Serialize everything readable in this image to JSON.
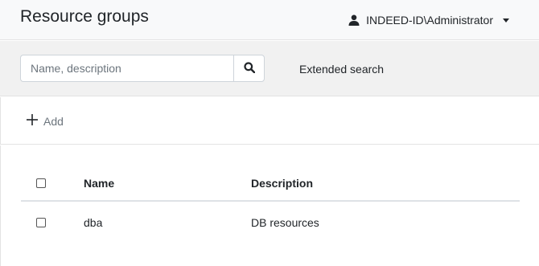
{
  "header": {
    "title": "Resource groups",
    "user": {
      "name": "INDEED-ID\\Administrator",
      "icon": "user-icon"
    }
  },
  "search": {
    "placeholder": "Name, description",
    "value": "",
    "button_icon": "search-icon",
    "extended_label": "Extended search"
  },
  "toolbar": {
    "add_label": "Add",
    "add_icon": "plus-icon"
  },
  "table": {
    "columns": [
      "Name",
      "Description"
    ],
    "rows": [
      {
        "name": "dba",
        "description": "DB resources",
        "checked": false
      }
    ]
  }
}
